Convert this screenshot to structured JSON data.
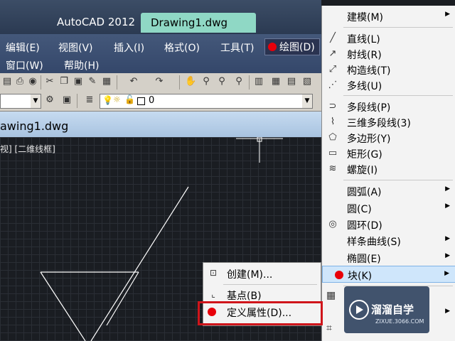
{
  "title": {
    "app": "AutoCAD 2012",
    "document": "Drawing1.dwg"
  },
  "menubar": {
    "row1": [
      "编辑(E)",
      "视图(V)",
      "插入(I)",
      "格式(O)",
      "工具(T)",
      "绘图(D)"
    ],
    "row2": [
      "窗口(W)",
      "帮助(H)"
    ]
  },
  "toolbar2": {
    "layer_value": "0"
  },
  "doctab": {
    "label": "awing1.dwg"
  },
  "viewport": {
    "label": "视] [二维线框]"
  },
  "draw_menu": {
    "items": [
      {
        "label": "建模(M)",
        "icon": "none",
        "submenu": true
      },
      {
        "label": "直线(L)",
        "icon": "line-icon"
      },
      {
        "label": "射线(R)",
        "icon": "ray-icon"
      },
      {
        "label": "构造线(T)",
        "icon": "construction-line-icon"
      },
      {
        "label": "多线(U)",
        "icon": "multiline-icon"
      },
      {
        "label": "多段线(P)",
        "icon": "polyline-icon"
      },
      {
        "label": "三维多段线(3)",
        "icon": "3d-polyline-icon"
      },
      {
        "label": "多边形(Y)",
        "icon": "polygon-icon"
      },
      {
        "label": "矩形(G)",
        "icon": "rectangle-icon"
      },
      {
        "label": "螺旋(I)",
        "icon": "helix-icon"
      },
      {
        "label": "圆弧(A)",
        "icon": "none",
        "submenu": true
      },
      {
        "label": "圆(C)",
        "icon": "none",
        "submenu": true
      },
      {
        "label": "圆环(D)",
        "icon": "donut-icon"
      },
      {
        "label": "样条曲线(S)",
        "icon": "none",
        "submenu": true
      },
      {
        "label": "椭圆(E)",
        "icon": "none",
        "submenu": true
      },
      {
        "label": "块(K)",
        "icon": "none",
        "submenu": true,
        "highlighted": true
      }
    ]
  },
  "block_submenu": {
    "items": [
      {
        "label": "创建(M)...",
        "icon": "create-block-icon"
      },
      {
        "label": "基点(B)",
        "icon": "base-point-icon"
      },
      {
        "label": "定义属性(D)...",
        "icon": "none"
      }
    ]
  },
  "watermark": {
    "title": "溜溜自学",
    "url": "ZIXUE.3066.COM"
  },
  "colors": {
    "marker": "#e8000a",
    "highlight_box": "#d0151b",
    "accent": "#8fd8c5"
  }
}
